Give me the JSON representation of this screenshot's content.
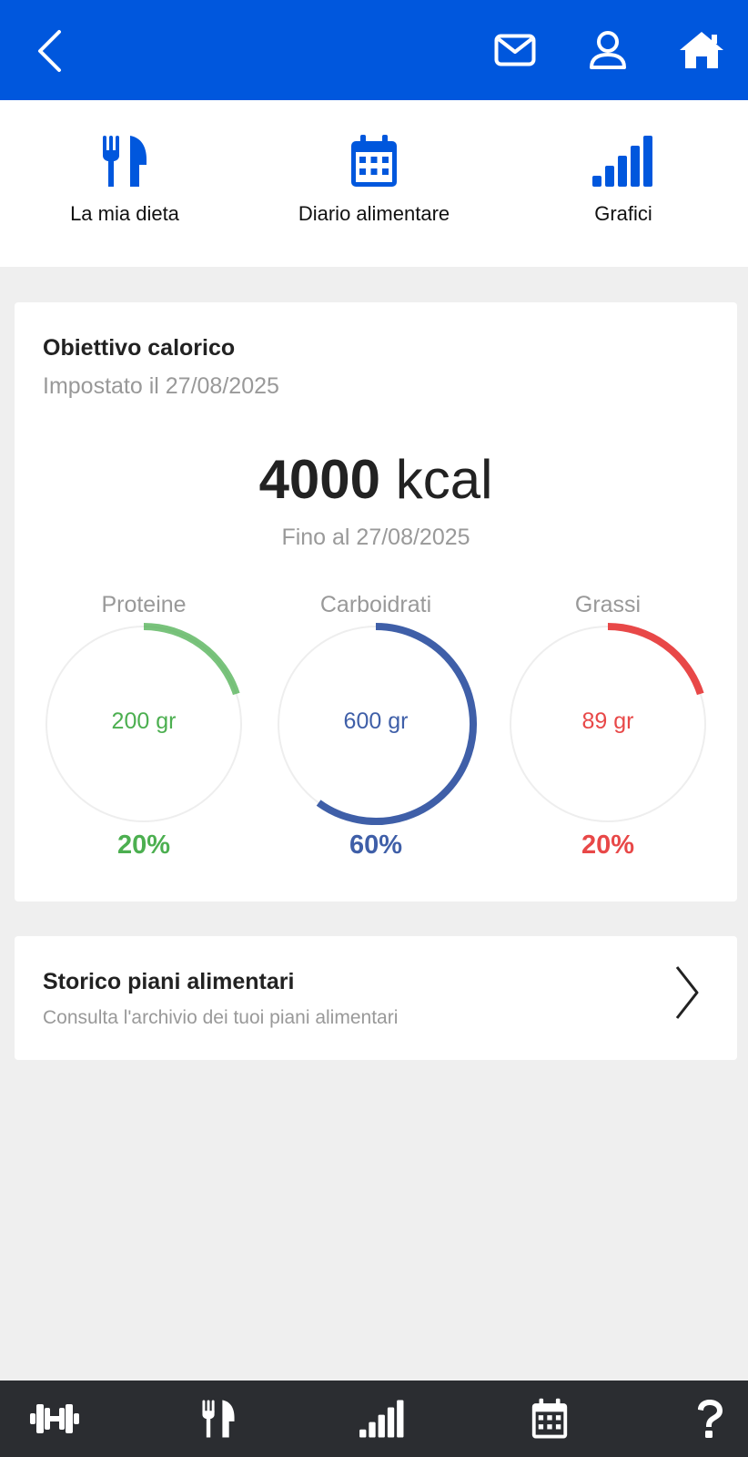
{
  "colors": {
    "brand": "#0057dd",
    "protein": "#4caf50",
    "carbs": "#3f5fa8",
    "fat": "#e84848",
    "track": "#eeeeee",
    "bottom_bar": "#2b2d31"
  },
  "topbar": {
    "icons": [
      "chevron-left-icon",
      "mail-icon",
      "user-icon",
      "home-icon"
    ]
  },
  "nav_tabs": [
    {
      "icon": "cutlery-icon",
      "label": "La mia dieta"
    },
    {
      "icon": "calendar-icon",
      "label": "Diario alimentare"
    },
    {
      "icon": "bar-chart-icon",
      "label": "Grafici"
    }
  ],
  "goal": {
    "title": "Obiettivo calorico",
    "set_on": "Impostato il 27/08/2025",
    "kcal_value": "4000",
    "kcal_unit": "kcal",
    "until": "Fino al 27/08/2025",
    "macros": [
      {
        "name": "Proteine",
        "grams": "200 gr",
        "percent": "20%",
        "fraction": 0.2,
        "color": "#4caf50"
      },
      {
        "name": "Carboidrati",
        "grams": "600 gr",
        "percent": "60%",
        "fraction": 0.6,
        "color": "#3f5fa8"
      },
      {
        "name": "Grassi",
        "grams": "89 gr",
        "percent": "20%",
        "fraction": 0.2,
        "color": "#e84848"
      }
    ]
  },
  "history": {
    "title": "Storico piani alimentari",
    "subtitle": "Consulta l'archivio dei tuoi piani alimentari"
  },
  "bottom_nav": [
    "dumbbell-icon",
    "cutlery-icon",
    "bar-chart-icon",
    "calendar-icon",
    "question-icon"
  ]
}
